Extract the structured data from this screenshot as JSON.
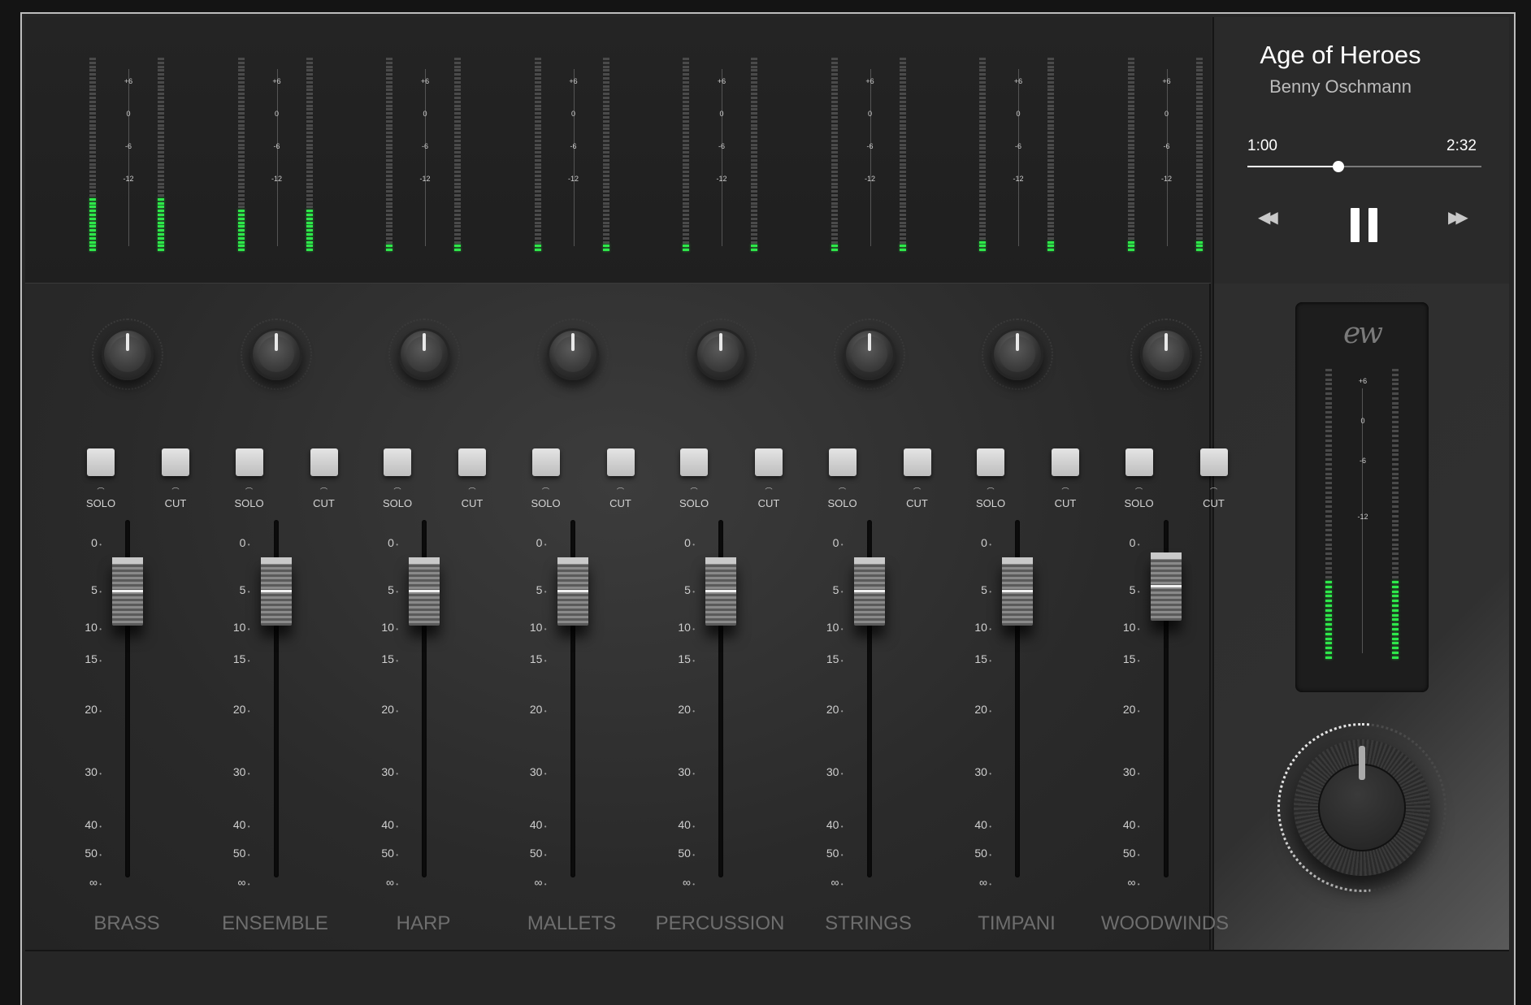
{
  "player": {
    "title": "Age of Heroes",
    "artist": "Benny Oschmann",
    "time_current": "1:00",
    "time_total": "2:32",
    "progress": 0.39,
    "rewind_icon": "rewind-icon",
    "pause_icon": "pause-icon",
    "forward_icon": "fast-forward-icon"
  },
  "meter_scale": [
    "+6",
    "0",
    "-6",
    "-12"
  ],
  "fader_scale": [
    "0",
    "5",
    "10",
    "15",
    "20",
    "30",
    "40",
    "50",
    "∞"
  ],
  "buttons": {
    "solo": "SOLO",
    "cut": "CUT"
  },
  "channels": [
    {
      "name": "BRASS",
      "meter_left": 0.27,
      "meter_right": 0.27,
      "fader": 5
    },
    {
      "name": "ENSEMBLE",
      "meter_left": 0.21,
      "meter_right": 0.21,
      "fader": 5
    },
    {
      "name": "HARP",
      "meter_left": 0.03,
      "meter_right": 0.03,
      "fader": 5
    },
    {
      "name": "MALLETS",
      "meter_left": 0.03,
      "meter_right": 0.03,
      "fader": 5
    },
    {
      "name": "PERCUSSION",
      "meter_left": 0.03,
      "meter_right": 0.03,
      "fader": 5
    },
    {
      "name": "STRINGS",
      "meter_left": 0.03,
      "meter_right": 0.03,
      "fader": 5
    },
    {
      "name": "TIMPANI",
      "meter_left": 0.05,
      "meter_right": 0.05,
      "fader": 5
    },
    {
      "name": "WOODWINDS",
      "meter_left": 0.05,
      "meter_right": 0.05,
      "fader": 4.5
    }
  ],
  "master": {
    "logo": "ew",
    "meter_left": 0.27,
    "meter_right": 0.27,
    "knob_icon": "master-volume-knob"
  },
  "colors": {
    "meter_on": "#2ee84a",
    "meter_off": "#4a4a4a",
    "background": "#262626"
  }
}
